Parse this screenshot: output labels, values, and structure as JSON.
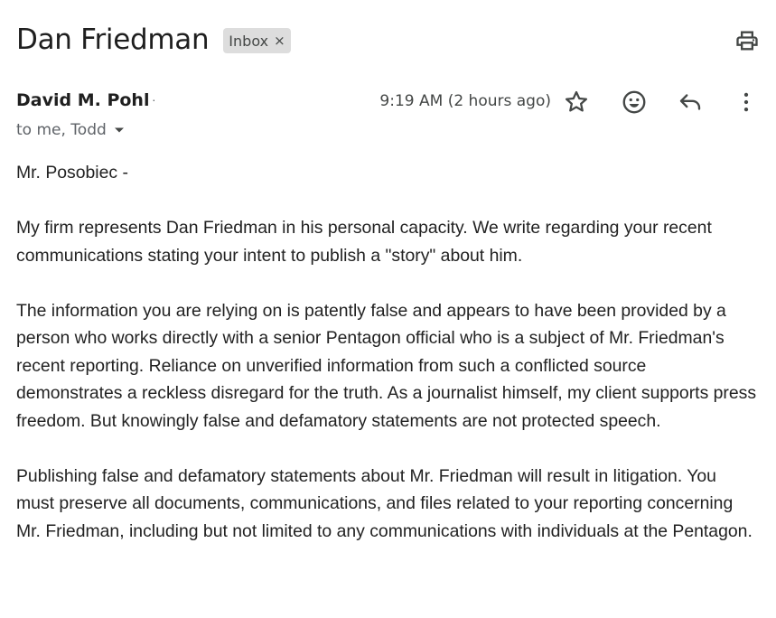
{
  "email": {
    "subject": "Dan Friedman",
    "label": "Inbox",
    "label_remove": "×",
    "sender": {
      "name": "David M. Pohl",
      "separator": "·"
    },
    "timestamp": "9:19 AM (2 hours ago)",
    "recipients": "to me, Todd",
    "body": {
      "greeting": "Mr. Posobiec -",
      "paragraphs": [
        "My firm represents Dan Friedman in his personal capacity. We write regarding your recent communications stating your intent to publish a \"story\" about him.",
        "The information you are relying on is patently false and appears to have been provided by a person who works directly with a senior Pentagon official who is a subject of Mr. Friedman's recent reporting. Reliance on unverified information from such a conflicted source demonstrates a reckless disregard for the truth. As a journalist himself, my client supports press freedom. But knowingly false and defamatory statements are not protected speech.",
        "Publishing false and defamatory statements about Mr. Friedman will result in litigation. You must preserve all documents, communications, and files related to your reporting concerning Mr. Friedman, including but not limited to any communications with individuals at the Pentagon."
      ]
    }
  },
  "icons": {
    "print": "print-icon",
    "star": "star-icon",
    "emoji": "emoji-reaction-icon",
    "reply": "reply-icon",
    "more": "more-vertical-icon",
    "recipients_caret": "caret-down-icon"
  },
  "colors": {
    "text_primary": "#1f1f1f",
    "text_secondary": "#5f6368",
    "chip_bg": "#dddddd",
    "icon": "#444746"
  }
}
